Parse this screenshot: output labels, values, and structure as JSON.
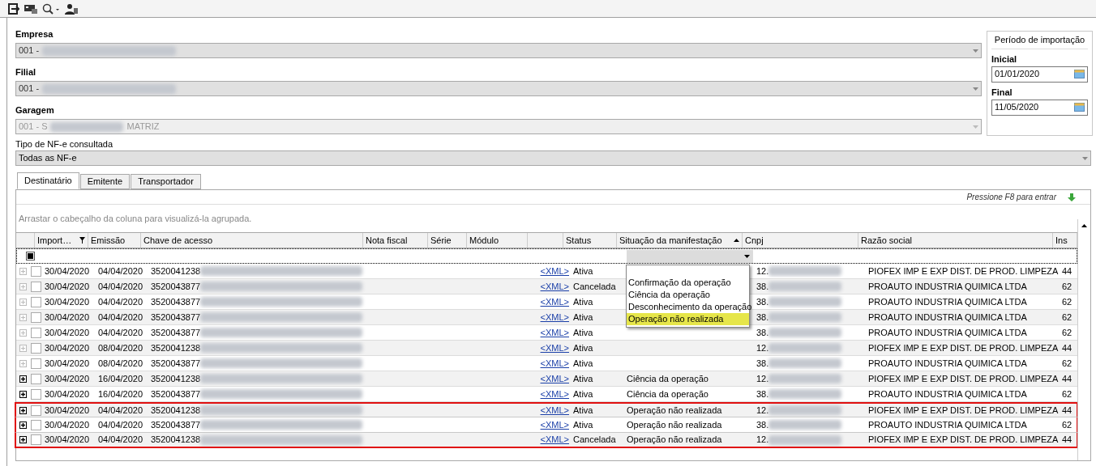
{
  "fields": [
    {
      "label": "Empresa",
      "value": "001 -",
      "disabled": false
    },
    {
      "label": "Filial",
      "value": "001 -",
      "disabled": false
    },
    {
      "label": "Garagem",
      "value": "001 - S",
      "value_suffix": "MATRIZ",
      "disabled": true
    }
  ],
  "period": {
    "title": "Período de importação",
    "dates": [
      {
        "label": "Inicial",
        "value": "01/01/2020"
      },
      {
        "label": "Final",
        "value": "11/05/2020"
      }
    ]
  },
  "nfe_type": {
    "label": "Tipo de NF-e consultada",
    "value": "Todas as NF-e"
  },
  "tabs": [
    {
      "label": "Destinatário",
      "selected": true
    },
    {
      "label": "Emitente",
      "selected": false
    },
    {
      "label": "Transportador",
      "selected": false
    }
  ],
  "hint": "Pressione F8 para entrar",
  "group_hint": "Arrastar o cabeçalho da coluna para visualizá-la agrupada.",
  "columns": [
    "Import…",
    "Emissão",
    "Chave de acesso",
    "Nota fiscal",
    "Série",
    "Módulo",
    "Status",
    "Situação da manifestação",
    "Cnpj",
    "Razão social",
    "Ins"
  ],
  "select_all": {
    "indeterminate": true
  },
  "filter_dropdown": {
    "options": [
      {
        "label": "Confirmação da operação",
        "selected": false
      },
      {
        "label": "Ciência da operação",
        "selected": false
      },
      {
        "label": "Desconhecimento da operação",
        "selected": false
      },
      {
        "label": "Operação não realizada",
        "selected": true
      }
    ]
  },
  "rows": [
    {
      "import": "30/04/2020",
      "emissao": "04/04/2020",
      "chave": "3520041238",
      "xml": "<XML>",
      "status": "Ativa",
      "cnpj": "12.",
      "razao": "PIOFEX IMP E EXP DIST. DE PROD. LIMPEZA",
      "ins": "44",
      "expand_active": false,
      "checked": false,
      "highlighted": false
    },
    {
      "import": "30/04/2020",
      "emissao": "04/04/2020",
      "chave": "3520043877",
      "xml": "<XML>",
      "status": "Cancelada",
      "cnpj": "38.",
      "razao": "PROAUTO INDUSTRIA QUIMICA LTDA",
      "ins": "62",
      "expand_active": false,
      "checked": false,
      "highlighted": false
    },
    {
      "import": "30/04/2020",
      "emissao": "04/04/2020",
      "chave": "3520043877",
      "xml": "<XML>",
      "status": "Ativa",
      "cnpj": "38.",
      "razao": "PROAUTO INDUSTRIA QUIMICA LTDA",
      "ins": "62",
      "expand_active": false,
      "checked": false,
      "highlighted": false
    },
    {
      "import": "30/04/2020",
      "emissao": "04/04/2020",
      "chave": "3520043877",
      "xml": "<XML>",
      "status": "Ativa",
      "cnpj": "38.",
      "razao": "PROAUTO INDUSTRIA QUIMICA LTDA",
      "ins": "62",
      "expand_active": false,
      "checked": false,
      "highlighted": false
    },
    {
      "import": "30/04/2020",
      "emissao": "04/04/2020",
      "chave": "3520043877",
      "xml": "<XML>",
      "status": "Ativa",
      "cnpj": "38.",
      "razao": "PROAUTO INDUSTRIA QUIMICA LTDA",
      "ins": "62",
      "expand_active": false,
      "checked": false,
      "highlighted": false
    },
    {
      "import": "30/04/2020",
      "emissao": "08/04/2020",
      "chave": "3520041238",
      "xml": "<XML>",
      "status": "Ativa",
      "cnpj": "12.",
      "razao": "PIOFEX IMP E EXP DIST. DE PROD. LIMPEZA",
      "ins": "44",
      "expand_active": false,
      "checked": false,
      "highlighted": false
    },
    {
      "import": "30/04/2020",
      "emissao": "08/04/2020",
      "chave": "3520043877",
      "xml": "<XML>",
      "status": "Ativa",
      "cnpj": "38.",
      "razao": "PROAUTO INDUSTRIA QUIMICA LTDA",
      "ins": "62",
      "expand_active": false,
      "checked": false,
      "highlighted": false
    },
    {
      "import": "30/04/2020",
      "emissao": "16/04/2020",
      "chave": "3520041238",
      "xml": "<XML>",
      "status": "Ativa",
      "situacao": "Ciência da operação",
      "cnpj": "12.",
      "razao": "PIOFEX IMP E EXP DIST. DE PROD. LIMPEZA",
      "ins": "44",
      "expand_active": true,
      "checked": false,
      "highlighted": false
    },
    {
      "import": "30/04/2020",
      "emissao": "16/04/2020",
      "chave": "3520043877",
      "xml": "<XML>",
      "status": "Ativa",
      "situacao": "Ciência da operação",
      "cnpj": "38.",
      "razao": "PROAUTO INDUSTRIA QUIMICA LTDA",
      "ins": "62",
      "expand_active": true,
      "checked": false,
      "highlighted": false
    },
    {
      "import": "30/04/2020",
      "emissao": "04/04/2020",
      "chave": "3520041238",
      "xml": "<XML>",
      "status": "Ativa",
      "situacao": "Operação não realizada",
      "cnpj": "12.",
      "razao": "PIOFEX IMP E EXP DIST. DE PROD. LIMPEZA",
      "ins": "44",
      "expand_active": true,
      "checked": false,
      "highlighted": true
    },
    {
      "import": "30/04/2020",
      "emissao": "04/04/2020",
      "chave": "3520043877",
      "xml": "<XML>",
      "status": "Ativa",
      "situacao": "Operação não realizada",
      "cnpj": "38.",
      "razao": "PROAUTO INDUSTRIA QUIMICA LTDA",
      "ins": "62",
      "expand_active": true,
      "checked": false,
      "highlighted": true
    },
    {
      "import": "30/04/2020",
      "emissao": "04/04/2020",
      "chave": "3520041238",
      "xml": "<XML>",
      "status": "Cancelada",
      "situacao": "Operação não realizada",
      "cnpj": "12.",
      "razao": "PIOFEX IMP E EXP DIST. DE PROD. LIMPEZA",
      "ins": "44",
      "expand_active": true,
      "checked": false,
      "highlighted": true
    }
  ]
}
